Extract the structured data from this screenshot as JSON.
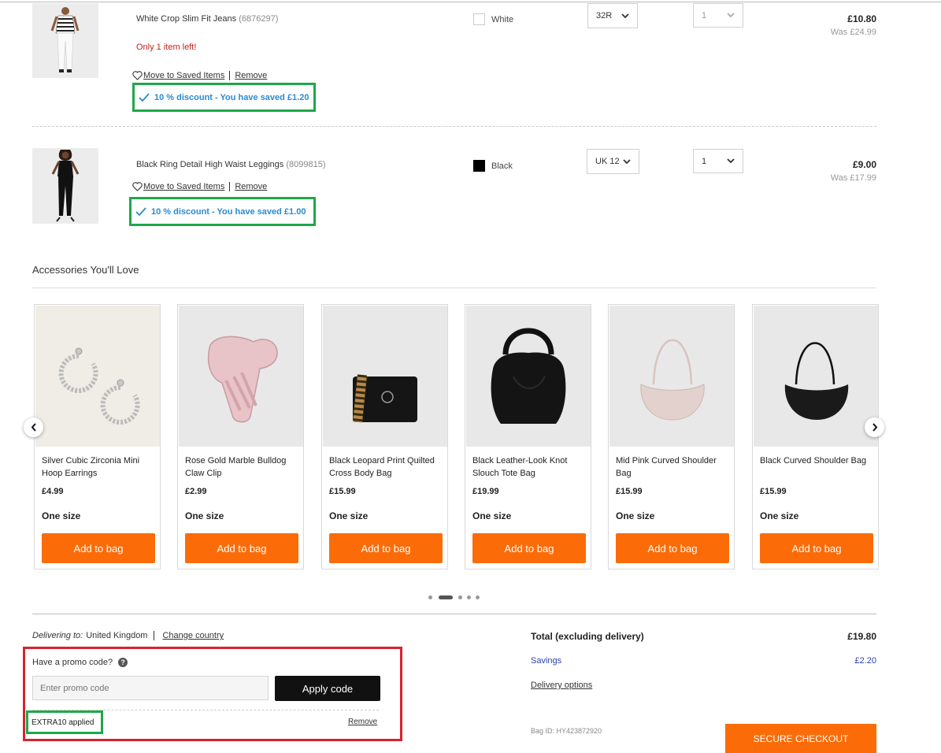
{
  "bag": {
    "items": [
      {
        "name": "White Crop Slim Fit Jeans",
        "code": "(6876297)",
        "stock_note": "Only 1 item left!",
        "save_link": "Move to Saved Items",
        "remove_link": "Remove",
        "discount": "10 % discount - You have saved £1.20",
        "colour": "White",
        "colour_hex": "#ffffff",
        "size": "32R",
        "quantity": "1",
        "price": "£10.80",
        "was_price": "Was £24.99"
      },
      {
        "name": "Black Ring Detail High Waist Leggings",
        "code": "(8099815)",
        "save_link": "Move to Saved Items",
        "remove_link": "Remove",
        "discount": "10 % discount - You have saved £1.00",
        "colour": "Black",
        "colour_hex": "#000000",
        "size": "UK 12",
        "quantity": "1",
        "price": "£9.00",
        "was_price": "Was £17.99"
      }
    ]
  },
  "accessories": {
    "title": "Accessories You'll Love",
    "prev_icon": "chevron-left-icon",
    "next_icon": "chevron-right-icon",
    "products": [
      {
        "name": "Silver Cubic Zirconia Mini Hoop Earrings",
        "price": "£4.99",
        "size": "One size",
        "button": "Add to bag"
      },
      {
        "name": "Rose Gold Marble Bulldog Claw Clip",
        "price": "£2.99",
        "size": "One size",
        "button": "Add to bag"
      },
      {
        "name": "Black Leopard Print Quilted Cross Body Bag",
        "price": "£15.99",
        "size": "One size",
        "button": "Add to bag"
      },
      {
        "name": "Black Leather-Look Knot Slouch Tote Bag",
        "price": "£19.99",
        "size": "One size",
        "button": "Add to bag"
      },
      {
        "name": "Mid Pink Curved Shoulder Bag",
        "price": "£15.99",
        "size": "One size",
        "button": "Add to bag"
      },
      {
        "name": "Black Curved Shoulder Bag",
        "price": "£15.99",
        "size": "One size",
        "button": "Add to bag"
      }
    ],
    "active_page": 2,
    "page_count": 5
  },
  "delivery": {
    "label": "Delivering to:",
    "country": "United Kingdom",
    "change": "Change country"
  },
  "promo": {
    "label": "Have a promo code?",
    "help_icon": "?",
    "placeholder": "Enter promo code",
    "apply": "Apply code",
    "applied": "EXTRA10 applied",
    "remove": "Remove"
  },
  "summary": {
    "total_label": "Total (excluding delivery)",
    "total": "£19.80",
    "savings_label": "Savings",
    "savings": "£2.20",
    "delivery_options": "Delivery options",
    "bag_id": "Bag ID: HY423872920",
    "checkout": "SECURE CHECKOUT"
  },
  "colors": {
    "accent": "#fb6c08",
    "discount_text": "#2a8bd0",
    "highlight_green": "#1ea84a",
    "highlight_red": "#d7232f",
    "low_stock": "#c0231c",
    "savings": "#2d3fb0"
  }
}
